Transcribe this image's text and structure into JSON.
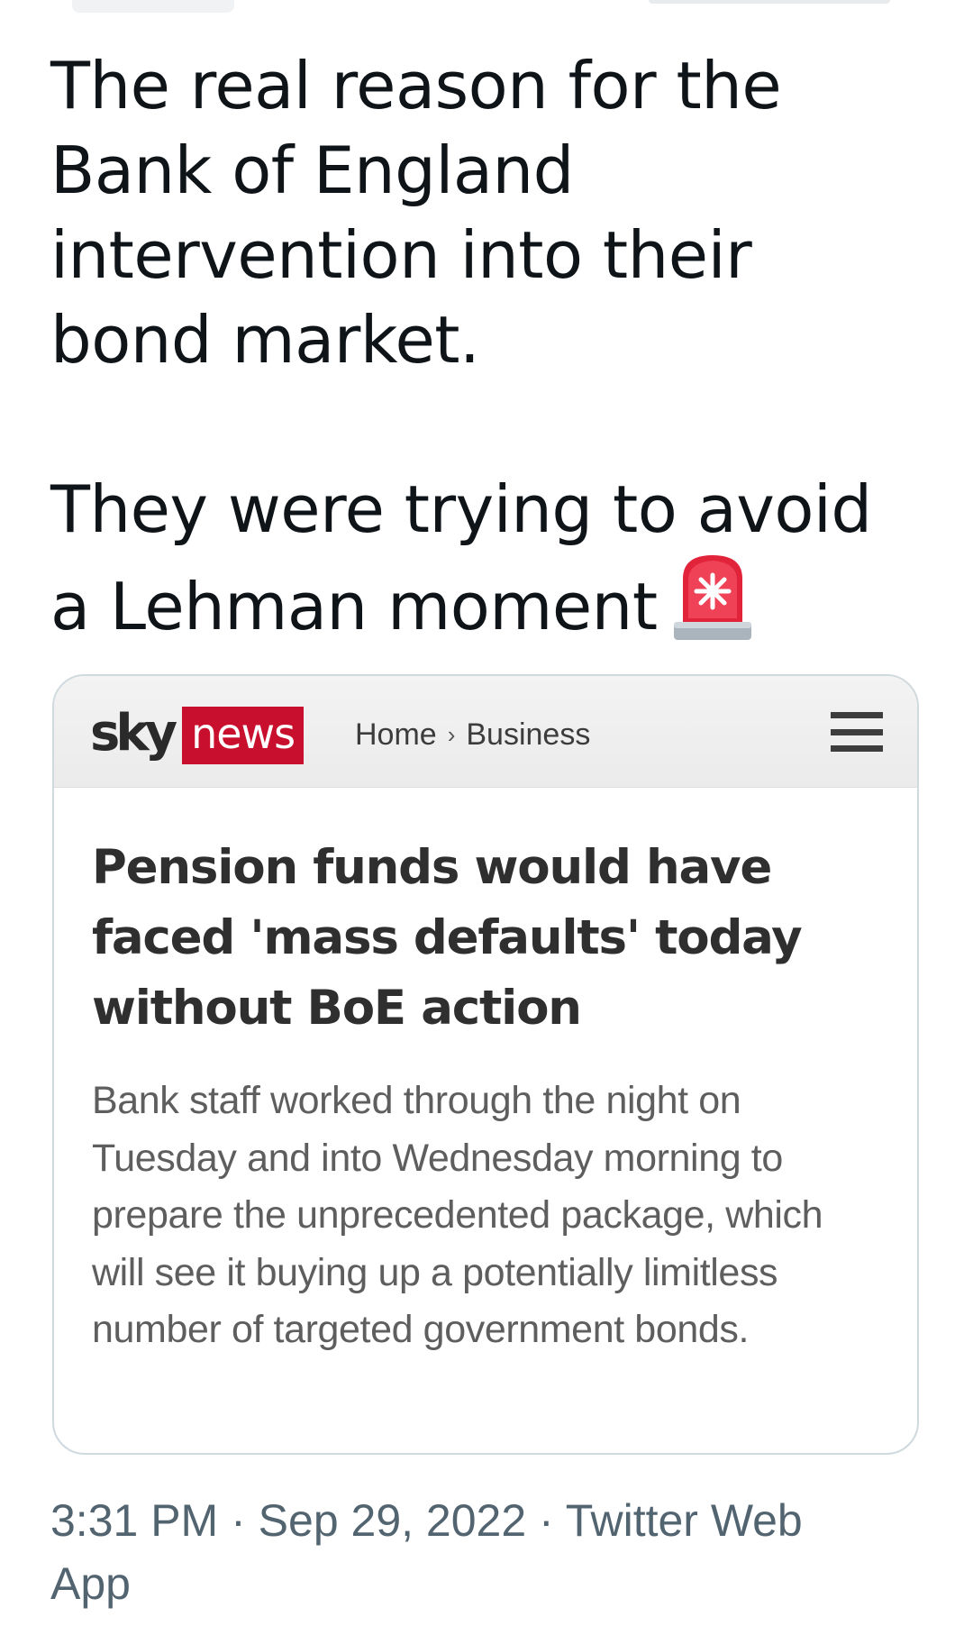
{
  "tweet": {
    "text_line_1": "The real reason for the Bank of England intervention into their bond market.",
    "text_line_2": "They were trying to avoid a Lehman moment",
    "emoji": "police-car-light-icon"
  },
  "card": {
    "logo_sky": "sky",
    "logo_news": "news",
    "breadcrumb_home": "Home",
    "breadcrumb_separator": "›",
    "breadcrumb_section": "Business",
    "menu_icon": "hamburger-menu-icon",
    "headline": "Pension funds would have faced 'mass defaults' today without BoE action",
    "standfirst": "Bank staff worked through the night on Tuesday and into Wednesday morning to prepare the unprecedented package, which will see it buying up a potentially limitless number of targeted government bonds.",
    "brand_color": "#c8102e"
  },
  "meta": {
    "time": "3:31 PM",
    "separator": " · ",
    "date": "Sep 29, 2022",
    "source": "Twitter Web App"
  }
}
